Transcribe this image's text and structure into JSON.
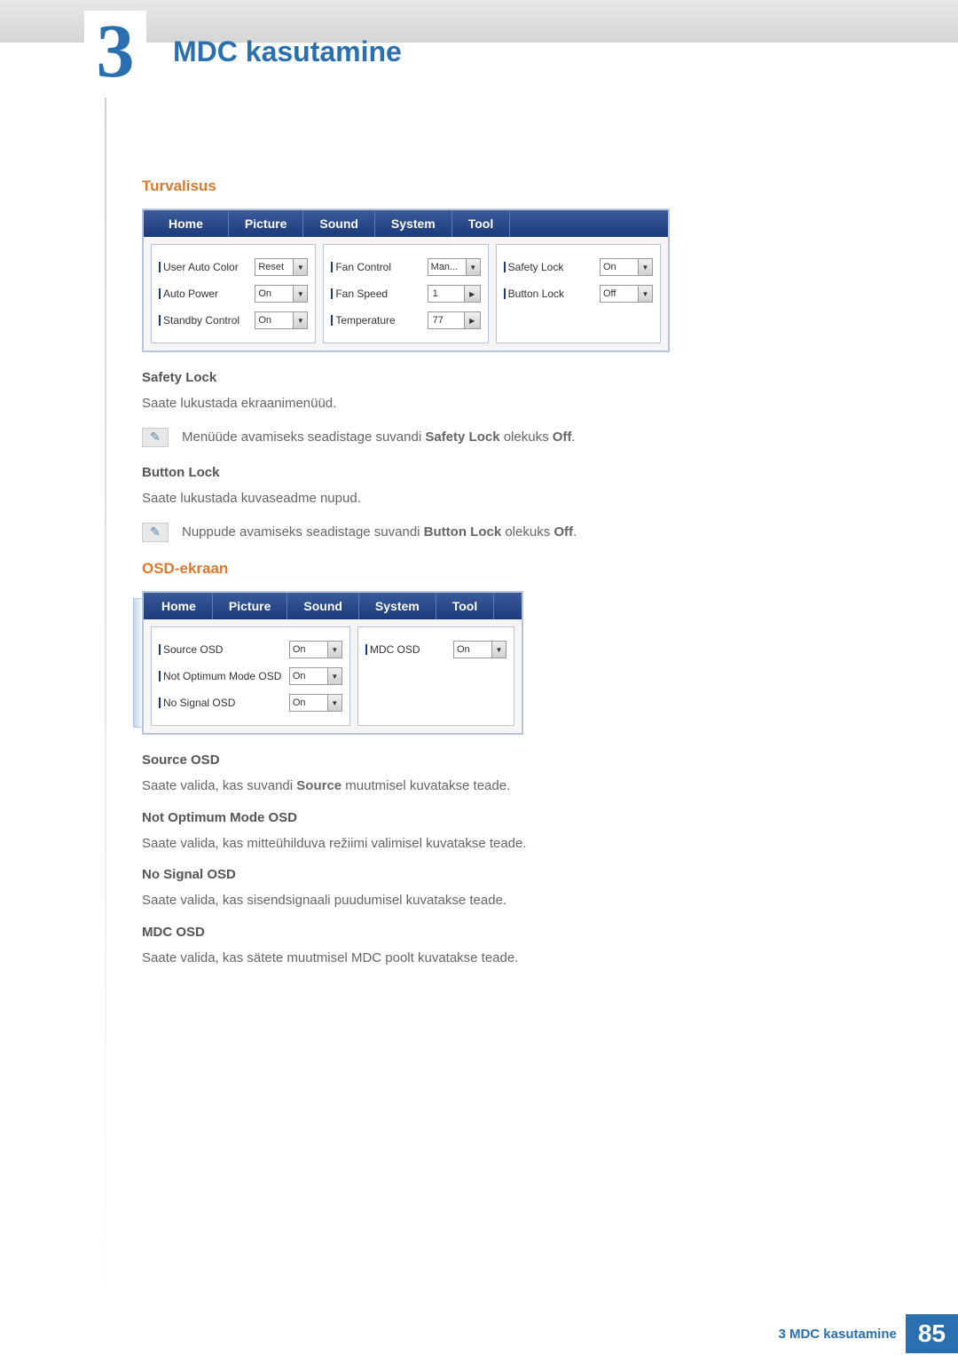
{
  "chapter": {
    "number": "3",
    "title": "MDC kasutamine"
  },
  "sections": {
    "security": {
      "heading": "Turvalisus",
      "panel": {
        "tabs": [
          "Home",
          "Picture",
          "Sound",
          "System",
          "Tool"
        ],
        "col1": [
          {
            "label": "User Auto Color",
            "value": "Reset",
            "kind": "dd"
          },
          {
            "label": "Auto Power",
            "value": "On",
            "kind": "dd"
          },
          {
            "label": "Standby Control",
            "value": "On",
            "kind": "dd"
          }
        ],
        "col2": [
          {
            "label": "Fan Control",
            "value": "Man...",
            "kind": "dd"
          },
          {
            "label": "Fan Speed",
            "value": "1",
            "kind": "spin"
          },
          {
            "label": "Temperature",
            "value": "77",
            "kind": "spin"
          }
        ],
        "col3": [
          {
            "label": "Safety Lock",
            "value": "On",
            "kind": "dd"
          },
          {
            "label": "Button Lock",
            "value": "Off",
            "kind": "dd"
          }
        ]
      },
      "safety_lock": {
        "h": "Safety Lock",
        "t": "Saate lukustada ekraanimenüüd.",
        "note_pre": "Menüüde avamiseks seadistage suvandi ",
        "note_b": "Safety Lock",
        "note_mid": " olekuks ",
        "note_b2": "Off",
        "note_post": "."
      },
      "button_lock": {
        "h": "Button Lock",
        "t": "Saate lukustada kuvaseadme nupud.",
        "note_pre": "Nuppude avamiseks seadistage suvandi ",
        "note_b": "Button Lock",
        "note_mid": " olekuks ",
        "note_b2": "Off",
        "note_post": "."
      }
    },
    "osd": {
      "heading": "OSD-ekraan",
      "panel": {
        "tabs": [
          "Home",
          "Picture",
          "Sound",
          "System",
          "Tool"
        ],
        "col1": [
          {
            "label": "Source OSD",
            "value": "On",
            "kind": "dd"
          },
          {
            "label": "Not Optimum Mode OSD",
            "value": "On",
            "kind": "dd"
          },
          {
            "label": "No Signal OSD",
            "value": "On",
            "kind": "dd"
          }
        ],
        "col2": [
          {
            "label": "MDC OSD",
            "value": "On",
            "kind": "dd"
          }
        ]
      },
      "items": [
        {
          "h": "Source OSD",
          "pre": "Saate valida, kas suvandi ",
          "b": "Source",
          "post": " muutmisel kuvatakse teade."
        },
        {
          "h": "Not Optimum Mode OSD",
          "t": "Saate valida, kas mitteühilduva režiimi valimisel kuvatakse teade."
        },
        {
          "h": "No Signal OSD",
          "t": "Saate valida, kas sisendsignaali puudumisel kuvatakse teade."
        },
        {
          "h": "MDC OSD",
          "t": "Saate valida, kas sätete muutmisel MDC poolt kuvatakse teade."
        }
      ]
    }
  },
  "footer": {
    "text": "3 MDC kasutamine",
    "page": "85"
  }
}
